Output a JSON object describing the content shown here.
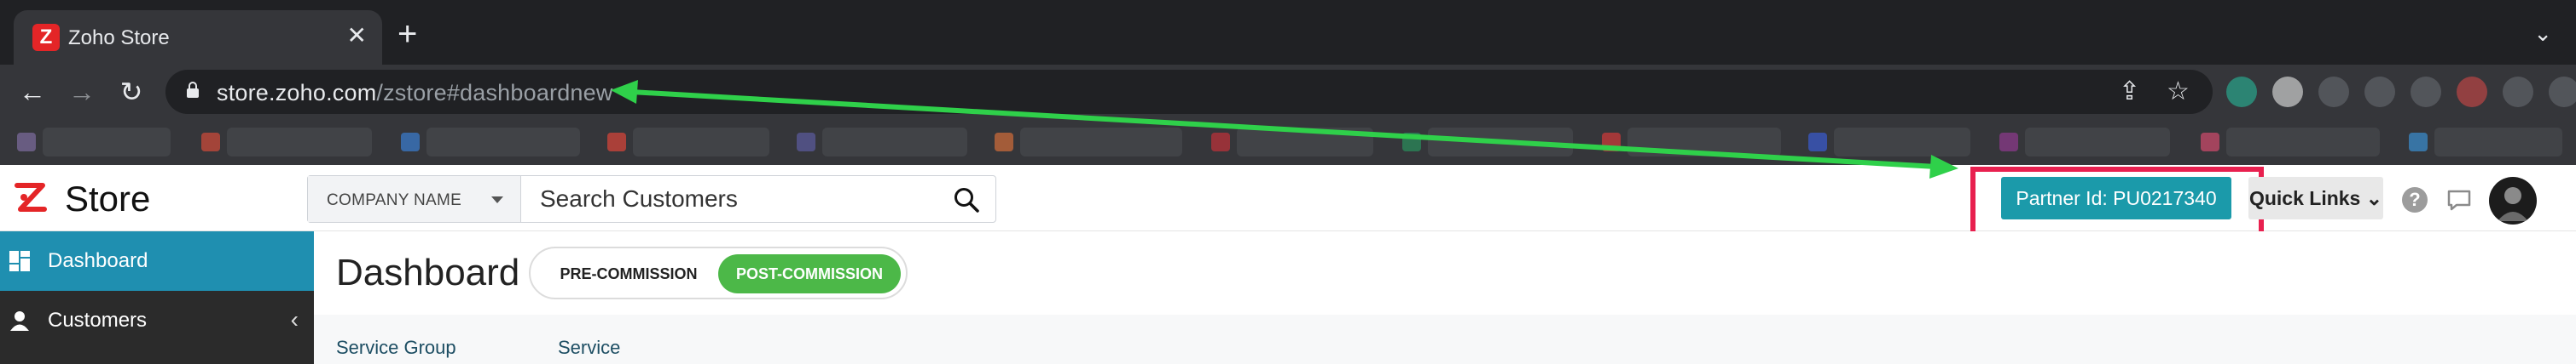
{
  "browser": {
    "tab_title": "Zoho Store",
    "tab_favicon_letter": "Z",
    "tab_close": "✕",
    "new_tab": "+",
    "tab_search": "⌄",
    "url_host": "store.zoho.com",
    "url_path": "/zstore#dashboardnew",
    "back_icon": "←",
    "forward_icon": "→",
    "reload_icon": "↻",
    "share_icon": "⇪",
    "bookmark_star": "☆"
  },
  "app": {
    "logo_text": "Store",
    "search": {
      "scope_label": "COMPANY NAME",
      "placeholder": "Search Customers"
    },
    "partner_id_label": "Partner Id: PU0217340",
    "quick_links_label": "Quick Links ⌄",
    "help_label": "?"
  },
  "sidebar": {
    "items": [
      {
        "label": "Dashboard",
        "active": true
      },
      {
        "label": "Customers",
        "active": false
      }
    ],
    "customers_chevron": "‹"
  },
  "main": {
    "title": "Dashboard",
    "toggle": {
      "option_off": "PRE-COMMISSION",
      "option_on": "POST-COMMISSION",
      "selected": "POST-COMMISSION"
    },
    "filters": [
      "Service Group",
      "Service"
    ]
  },
  "colors": {
    "accent_teal": "#1b9aaa",
    "sidebar_active": "#1f8fb0",
    "toggle_green": "#4cb848",
    "highlight_red": "#e8204f",
    "arrow_green": "#2fd04a"
  }
}
